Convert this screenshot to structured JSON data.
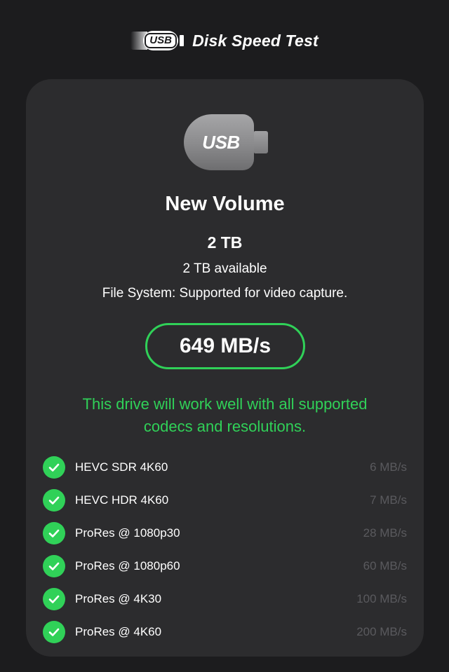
{
  "header": {
    "usb_badge": "USB",
    "title": "Disk Speed Test"
  },
  "drive": {
    "icon_label": "USB",
    "name": "New Volume",
    "capacity": "2 TB",
    "available": "2 TB available",
    "file_system": "File System: Supported for video capture."
  },
  "speed": {
    "value": "649 MB/s"
  },
  "verdict": {
    "line1": "This drive will work well with all supported",
    "line2": "codecs and resolutions."
  },
  "codecs": [
    {
      "label": "HEVC SDR 4K60",
      "rate": "6 MB/s",
      "icon": "checkmark-circle-icon"
    },
    {
      "label": "HEVC HDR 4K60",
      "rate": "7 MB/s",
      "icon": "checkmark-circle-icon"
    },
    {
      "label": "ProRes @ 1080p30",
      "rate": "28 MB/s",
      "icon": "checkmark-circle-icon"
    },
    {
      "label": "ProRes @ 1080p60",
      "rate": "60 MB/s",
      "icon": "checkmark-circle-icon"
    },
    {
      "label": "ProRes @ 4K30",
      "rate": "100 MB/s",
      "icon": "checkmark-circle-icon"
    },
    {
      "label": "ProRes @ 4K60",
      "rate": "200 MB/s",
      "icon": "checkmark-circle-icon"
    }
  ],
  "colors": {
    "background": "#1c1c1e",
    "card": "#2c2c2e",
    "accent_green": "#30d158",
    "muted_text": "#5a5a5e"
  }
}
